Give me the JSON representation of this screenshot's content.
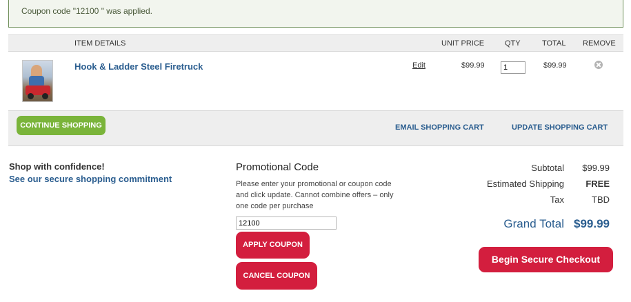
{
  "notice": {
    "message": "Coupon code \"12100 \" was applied."
  },
  "cart_table": {
    "headers": {
      "item_details": "ITEM DETAILS",
      "unit_price": "UNIT PRICE",
      "qty": "QTY",
      "total": "TOTAL",
      "remove": "REMOVE"
    },
    "items": [
      {
        "name": "Hook & Ladder Steel Firetruck",
        "edit_label": "Edit",
        "unit_price": "$99.99",
        "qty": "1",
        "total": "$99.99",
        "remove_icon": "close-circle-icon"
      }
    ]
  },
  "actions": {
    "continue_label": "CONTINUE SHOPPING",
    "email_label": "EMAIL SHOPPING CART",
    "update_label": "UPDATE SHOPPING CART"
  },
  "confidence": {
    "title": "Shop with confidence!",
    "link": "See our secure shopping commitment"
  },
  "promo": {
    "title": "Promotional Code",
    "description": "Please enter your promotional or coupon code and click update. Cannot combine offers – only one code per purchase",
    "code_value": "12100",
    "apply_label": "APPLY COUPON",
    "cancel_label": "CANCEL COUPON"
  },
  "summary": {
    "subtotal_label": "Subtotal",
    "subtotal_value": "$99.99",
    "shipping_label": "Estimated Shipping",
    "shipping_value": "FREE",
    "tax_label": "Tax",
    "tax_value": "TBD",
    "grand_total_label": "Grand Total",
    "grand_total_value": "$99.99",
    "checkout_label": "Begin Secure Checkout"
  },
  "colors": {
    "link_blue": "#2a5d8f",
    "accent_red": "#d31e3e",
    "continue_green": "#7ab43a"
  }
}
